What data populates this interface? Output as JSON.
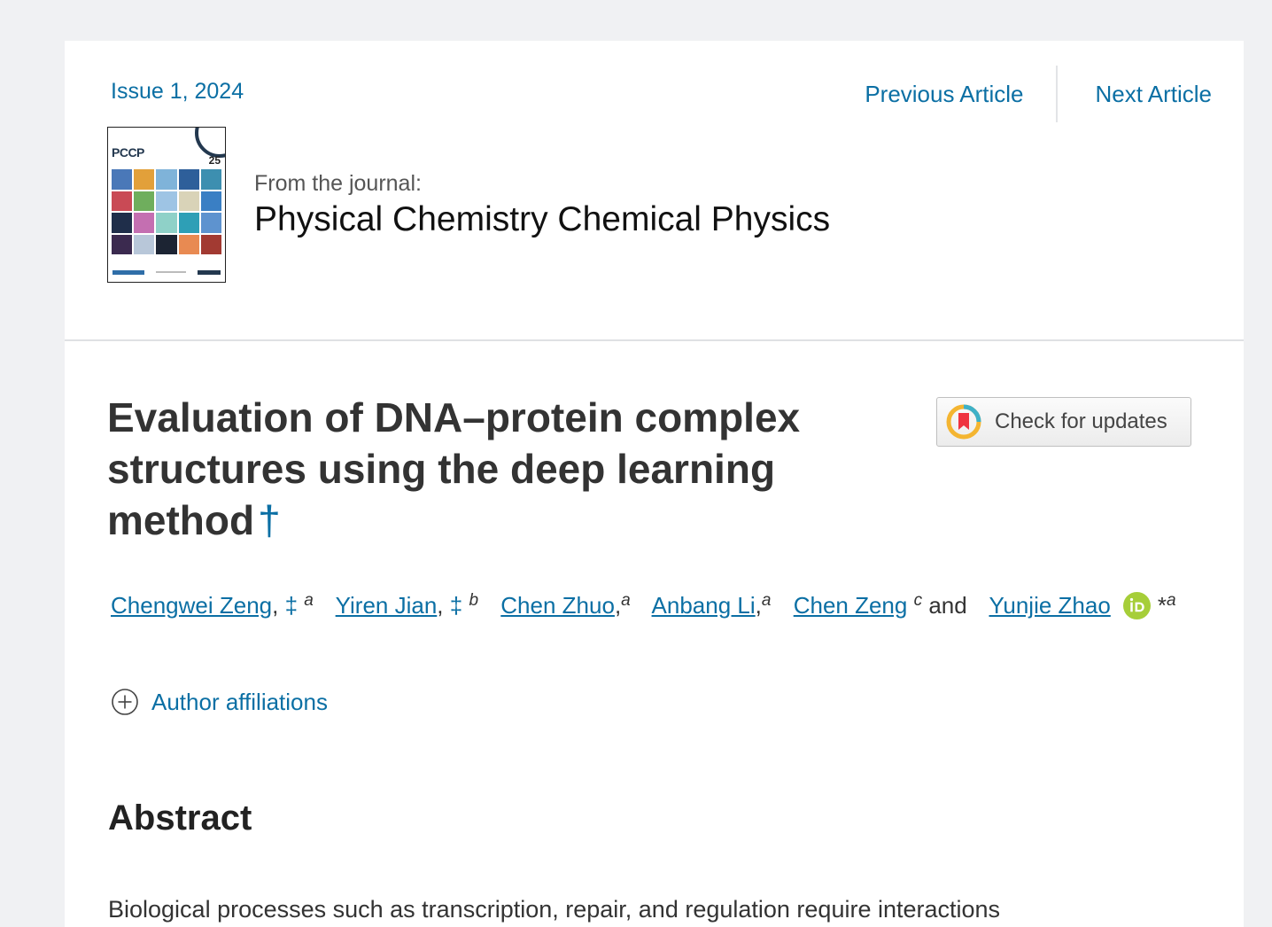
{
  "header": {
    "issue_label": "Issue 1, 2024",
    "previous_label": "Previous Article",
    "next_label": "Next Article"
  },
  "journal": {
    "from_label": "From the journal:",
    "name": "Physical Chemistry Chemical Physics",
    "cover": {
      "title": "PCCP",
      "volume": "25"
    }
  },
  "article": {
    "title": "Evaluation of DNA–protein complex structures using the deep learning method",
    "title_mark": "†",
    "check_updates_label": "Check for updates",
    "authors": [
      {
        "name": "Chengwei Zeng",
        "sep": ",",
        "mark": "‡",
        "sup": "a"
      },
      {
        "name": "Yiren Jian",
        "sep": ",",
        "mark": "‡",
        "sup": "b"
      },
      {
        "name": "Chen Zhuo",
        "sep": ",",
        "mark": "",
        "sup": "a"
      },
      {
        "name": "Anbang Li",
        "sep": ",",
        "mark": "",
        "sup": "a"
      },
      {
        "name": "Chen Zeng",
        "sep": "",
        "mark": "",
        "sup": "c"
      },
      {
        "name": "Yunjie Zhao",
        "sep": "",
        "mark": "*",
        "sup": "a"
      }
    ],
    "and_label": "and",
    "affiliations_label": "Author affiliations",
    "abstract_heading": "Abstract",
    "abstract_text": "Biological processes such as transcription, repair, and regulation require interactions"
  },
  "colors": {
    "link": "#0b6fa4",
    "orcid": "#a6ce39",
    "page_background": "#f0f1f3"
  },
  "icons": {
    "check_updates": "crossmark-icon",
    "orcid": "orcid-icon",
    "expand": "plus-circle-icon"
  }
}
